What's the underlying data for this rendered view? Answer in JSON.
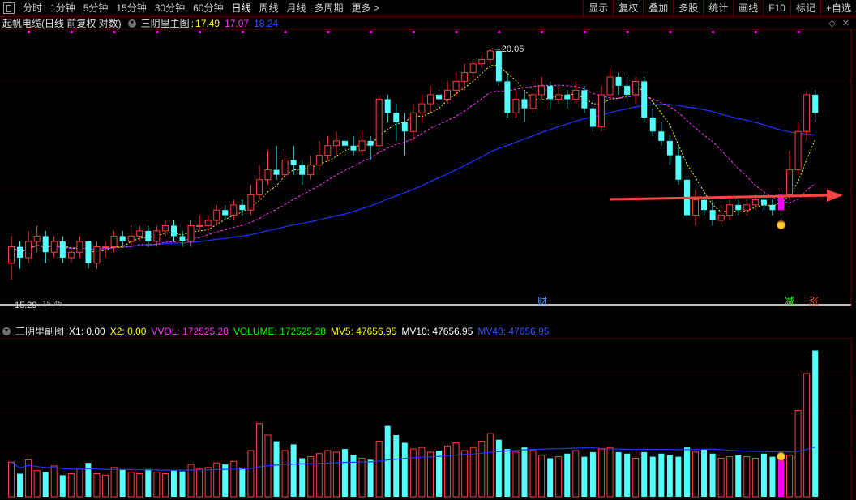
{
  "toolbar": {
    "periods": [
      "分时",
      "1分钟",
      "5分钟",
      "15分钟",
      "30分钟",
      "60分钟",
      "日线",
      "周线",
      "月线",
      "多周期",
      "更多 >"
    ],
    "active_period": "日线",
    "right_buttons": [
      "显示",
      "复权",
      "叠加",
      "多股",
      "统计",
      "画线",
      "F10",
      "标记",
      "+自选"
    ]
  },
  "main_legend": {
    "stock": "起帆电缆(日线 前复权 对数)",
    "indicator": "三阴里主图",
    "v1": "17.49",
    "v2": "17.07",
    "v3": "18.24",
    "c1": "#ffff00",
    "c2": "#ff33ff",
    "c3": "#3355ff"
  },
  "sub_legend": {
    "indicator": "三阴里副图",
    "items": [
      {
        "label": "X1: 0.00",
        "color": "#ffffff"
      },
      {
        "label": "X2: 0.00",
        "color": "#ffff00"
      },
      {
        "label": "VVOL: 172525.28",
        "color": "#ff33ff"
      },
      {
        "label": "VOLUME: 172525.28",
        "color": "#00ff00"
      },
      {
        "label": "MV5: 47656.95",
        "color": "#ffff00"
      },
      {
        "label": "MV10: 47656.95",
        "color": "#ffffff"
      },
      {
        "label": "MV40: 47656.95",
        "color": "#3355ff"
      }
    ]
  },
  "markers": {
    "high_label": "20.05",
    "low_label": "15.29",
    "low_label2": "15.45",
    "event1": "财",
    "event2": "减",
    "event3": "涨"
  },
  "colors": {
    "up": "#ff4040",
    "down": "#54ffff",
    "signal": "#ff00ff",
    "ma_fast": "#ffff00",
    "ma_mid": "#ff33ff",
    "ma_slow": "#2233ff",
    "arrow": "#ff4444"
  },
  "chart_data": {
    "type": "candlestick",
    "title": "起帆电缆(日线 前复权 对数)",
    "price_range": [
      15.0,
      20.4
    ],
    "candles": [
      [
        15.6,
        15.9,
        16.1,
        15.3
      ],
      [
        15.9,
        15.7,
        16.0,
        15.5
      ],
      [
        15.7,
        16.0,
        16.2,
        15.6
      ],
      [
        16.0,
        16.1,
        16.3,
        15.8
      ],
      [
        16.1,
        15.8,
        16.2,
        15.6
      ],
      [
        15.8,
        16.0,
        16.1,
        15.7
      ],
      [
        16.0,
        15.7,
        16.1,
        15.6
      ],
      [
        15.7,
        15.8,
        15.9,
        15.6
      ],
      [
        15.8,
        16.0,
        16.1,
        15.7
      ],
      [
        16.0,
        15.6,
        16.0,
        15.5
      ],
      [
        15.6,
        15.9,
        16.0,
        15.5
      ],
      [
        15.9,
        15.9,
        16.0,
        15.7
      ],
      [
        15.9,
        16.1,
        16.2,
        15.8
      ],
      [
        16.1,
        16.0,
        16.2,
        15.9
      ],
      [
        16.0,
        16.1,
        16.3,
        15.9
      ],
      [
        16.1,
        16.2,
        16.3,
        16.0
      ],
      [
        16.2,
        16.0,
        16.3,
        15.9
      ],
      [
        16.0,
        16.2,
        16.3,
        15.9
      ],
      [
        16.2,
        16.3,
        16.4,
        16.1
      ],
      [
        16.3,
        16.1,
        16.4,
        16.0
      ],
      [
        16.1,
        16.0,
        16.2,
        15.9
      ],
      [
        16.0,
        16.3,
        16.4,
        15.9
      ],
      [
        16.3,
        16.3,
        16.5,
        16.2
      ],
      [
        16.3,
        16.4,
        16.5,
        16.2
      ],
      [
        16.4,
        16.6,
        16.7,
        16.3
      ],
      [
        16.6,
        16.5,
        16.7,
        16.4
      ],
      [
        16.5,
        16.7,
        16.8,
        16.4
      ],
      [
        16.7,
        16.6,
        16.8,
        16.5
      ],
      [
        16.6,
        16.9,
        17.1,
        16.5
      ],
      [
        16.9,
        17.2,
        17.5,
        16.8
      ],
      [
        17.2,
        17.4,
        17.8,
        17.1
      ],
      [
        17.4,
        17.3,
        17.9,
        17.2
      ],
      [
        17.3,
        17.6,
        17.8,
        17.2
      ],
      [
        17.6,
        17.5,
        17.9,
        17.3
      ],
      [
        17.5,
        17.3,
        17.6,
        17.1
      ],
      [
        17.3,
        17.5,
        17.7,
        17.2
      ],
      [
        17.5,
        17.7,
        18.0,
        17.4
      ],
      [
        17.7,
        17.9,
        18.1,
        17.6
      ],
      [
        17.9,
        18.0,
        18.2,
        17.7
      ],
      [
        18.0,
        17.9,
        18.1,
        17.8
      ],
      [
        17.9,
        17.8,
        18.1,
        17.7
      ],
      [
        17.8,
        18.0,
        18.2,
        17.7
      ],
      [
        18.0,
        17.9,
        18.1,
        17.6
      ],
      [
        17.9,
        18.9,
        19.0,
        17.8
      ],
      [
        18.9,
        18.6,
        19.0,
        18.4
      ],
      [
        18.6,
        18.4,
        18.8,
        18.0
      ],
      [
        18.4,
        18.2,
        18.6,
        17.7
      ],
      [
        18.2,
        18.6,
        18.8,
        18.0
      ],
      [
        18.6,
        18.8,
        19.0,
        18.4
      ],
      [
        18.8,
        19.0,
        19.2,
        18.6
      ],
      [
        19.0,
        18.9,
        19.1,
        18.7
      ],
      [
        18.9,
        19.1,
        19.3,
        18.8
      ],
      [
        19.1,
        19.3,
        19.5,
        19.0
      ],
      [
        19.3,
        19.5,
        19.7,
        19.1
      ],
      [
        19.5,
        19.7,
        19.8,
        19.3
      ],
      [
        19.7,
        19.8,
        19.9,
        19.6
      ],
      [
        19.8,
        20.0,
        20.05,
        19.7
      ],
      [
        20.0,
        19.3,
        20.0,
        19.2
      ],
      [
        19.3,
        18.6,
        19.5,
        18.5
      ],
      [
        18.6,
        18.9,
        19.1,
        18.5
      ],
      [
        18.9,
        18.7,
        19.1,
        18.4
      ],
      [
        18.7,
        19.0,
        19.3,
        18.6
      ],
      [
        19.0,
        19.2,
        19.4,
        18.9
      ],
      [
        19.2,
        18.9,
        19.3,
        18.7
      ],
      [
        18.9,
        19.0,
        19.2,
        18.8
      ],
      [
        19.0,
        18.9,
        19.1,
        18.7
      ],
      [
        18.9,
        19.1,
        19.3,
        18.8
      ],
      [
        19.1,
        18.7,
        19.2,
        18.6
      ],
      [
        18.7,
        18.3,
        18.9,
        18.2
      ],
      [
        18.3,
        19.0,
        19.2,
        18.2
      ],
      [
        19.0,
        19.4,
        19.6,
        18.9
      ],
      [
        19.4,
        19.2,
        19.5,
        19.0
      ],
      [
        19.2,
        19.0,
        19.4,
        18.9
      ],
      [
        19.0,
        19.3,
        19.4,
        18.8
      ],
      [
        19.3,
        18.5,
        19.4,
        18.4
      ],
      [
        18.5,
        18.2,
        18.7,
        18.1
      ],
      [
        18.2,
        18.0,
        18.4,
        17.9
      ],
      [
        18.0,
        17.7,
        18.1,
        17.5
      ],
      [
        17.7,
        17.2,
        17.9,
        17.1
      ],
      [
        17.2,
        16.5,
        17.3,
        16.4
      ],
      [
        16.5,
        16.8,
        17.0,
        16.3
      ],
      [
        16.8,
        16.6,
        16.9,
        16.5
      ],
      [
        16.6,
        16.4,
        16.8,
        16.3
      ],
      [
        16.4,
        16.5,
        16.7,
        16.3
      ],
      [
        16.5,
        16.7,
        16.8,
        16.4
      ],
      [
        16.7,
        16.6,
        16.8,
        16.5
      ],
      [
        16.6,
        16.7,
        16.8,
        16.5
      ],
      [
        16.7,
        16.8,
        16.9,
        16.6
      ],
      [
        16.8,
        16.7,
        16.9,
        16.6
      ],
      [
        16.7,
        16.6,
        16.8,
        16.5
      ],
      [
        16.6,
        16.9,
        17.0,
        16.5
      ],
      [
        16.9,
        17.4,
        17.8,
        16.8
      ],
      [
        17.4,
        18.2,
        18.4,
        17.3
      ],
      [
        18.2,
        19.0,
        19.1,
        18.0
      ],
      [
        19.0,
        18.6,
        19.1,
        18.4
      ]
    ],
    "volumes": [
      45,
      30,
      48,
      34,
      32,
      40,
      28,
      30,
      36,
      44,
      30,
      28,
      38,
      35,
      32,
      30,
      36,
      32,
      30,
      34,
      33,
      42,
      36,
      38,
      44,
      42,
      46,
      38,
      60,
      95,
      80,
      72,
      60,
      68,
      50,
      52,
      56,
      60,
      58,
      62,
      54,
      50,
      48,
      72,
      92,
      80,
      70,
      62,
      64,
      58,
      60,
      66,
      70,
      60,
      64,
      72,
      82,
      74,
      62,
      58,
      64,
      60,
      54,
      50,
      52,
      56,
      60,
      52,
      58,
      62,
      64,
      58,
      56,
      50,
      58,
      52,
      56,
      54,
      52,
      64,
      58,
      62,
      56,
      50,
      52,
      54,
      52,
      50,
      56,
      52,
      48,
      54,
      112,
      160,
      190
    ],
    "xlabel": "",
    "ylabel": ""
  }
}
